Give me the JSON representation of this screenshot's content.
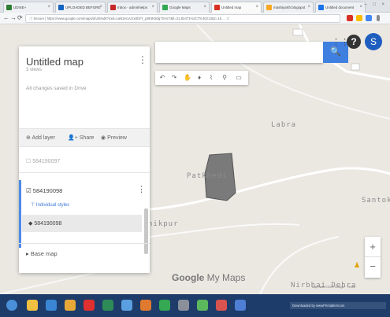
{
  "browser": {
    "tabs": [
      {
        "label": "UDISE+",
        "color": "#2e7d32"
      },
      {
        "label": "UPLOADED BEFORE",
        "color": "#1565c0"
      },
      {
        "label": "Inbox - adminhelps",
        "color": "#c62828"
      },
      {
        "label": "Google Maps",
        "color": "#34a853"
      },
      {
        "label": "Untitled map",
        "color": "#d93025",
        "active": true
      },
      {
        "label": "mashiyarth.blogspot",
        "color": "#f9a825"
      },
      {
        "label": "Untitled document",
        "color": "#1a73e8"
      }
    ],
    "window_controls": "– □ ×",
    "nav": {
      "back": "←",
      "forward": "→",
      "reload": "⟳"
    },
    "url": "ⓘ Secure | https://www.google.com/maps/d/u/0/edit?mid=1aN2ecvUzx0l3rY_p8KtN3dq7XHcT&ll=21.83471%2C78.40213&z=15 ... ☆"
  },
  "map": {
    "places": [
      "Labra",
      "Patkhedi",
      "Santok",
      "nikpur",
      "Nirbhai Dehra"
    ],
    "search": {
      "placeholder": "",
      "button_icon": "🔍"
    },
    "tools": [
      "↶",
      "↷",
      "✋",
      "♦",
      "⌇",
      "⚲",
      "▭"
    ],
    "apps_icon": "⋮⋮⋮",
    "help_label": "?",
    "avatar_letter": "S",
    "logo": {
      "google": "Google",
      "rest": " My Maps"
    },
    "zoom_in": "+",
    "zoom_out": "−",
    "pegman_icon": "♟",
    "attribution": "Map data ©2017 Google · Terms",
    "polygon_color": "#7a7a7a"
  },
  "panel": {
    "title": "Untitled map",
    "views": "3 views",
    "saved": "All changes saved in Drive",
    "menu": "⋮",
    "actions": [
      {
        "icon": "⊕",
        "label": "Add layer"
      },
      {
        "icon": "👤+",
        "label": "Share"
      },
      {
        "icon": "◉",
        "label": "Preview"
      }
    ],
    "layers": [
      {
        "label": "☐ 584190097"
      },
      {
        "label": "☑ 584190098",
        "styles": "Individual styles",
        "feature": "584190098"
      }
    ],
    "layer_menu": "⋮",
    "base_map": "Base map"
  },
  "taskbar": {
    "icons": [
      {
        "name": "start",
        "color": "#4a90d9"
      },
      {
        "name": "explorer",
        "color": "#f0c040"
      },
      {
        "name": "ie",
        "color": "#3a86d4"
      },
      {
        "name": "media",
        "color": "#e8a838"
      },
      {
        "name": "opera",
        "color": "#e03030"
      },
      {
        "name": "excel",
        "color": "#2e8b57"
      },
      {
        "name": "network",
        "color": "#5aa0e0"
      },
      {
        "name": "user",
        "color": "#e07a30"
      },
      {
        "name": "chrome",
        "color": "#34a853"
      },
      {
        "name": "notepad",
        "color": "#8a8f99"
      },
      {
        "name": "paint",
        "color": "#5cb85c"
      },
      {
        "name": "acrobat",
        "color": "#d9534f"
      },
      {
        "name": "bluetooth",
        "color": "#4f7fd4"
      }
    ],
    "watermark": "Downloaded by wwwPrintableXcom"
  }
}
